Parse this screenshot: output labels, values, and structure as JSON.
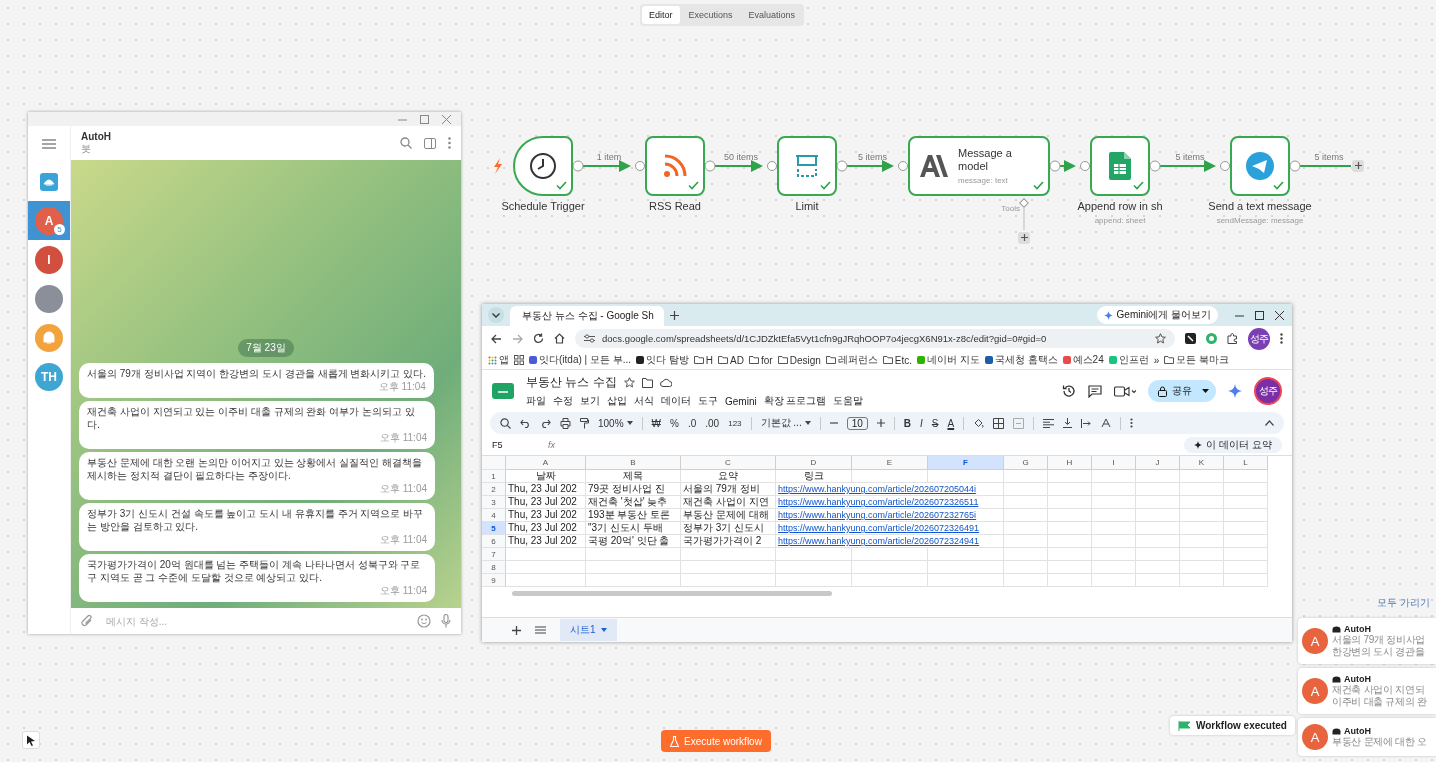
{
  "tabs": [
    {
      "label": "Editor",
      "selected": true
    },
    {
      "label": "Executions",
      "selected": false
    },
    {
      "label": "Evaluations",
      "selected": false
    }
  ],
  "workflow": {
    "nodes": [
      {
        "kind": "trigger",
        "name": "Schedule Trigger",
        "succeeded": true,
        "output_label": "1 item"
      },
      {
        "kind": "rss",
        "name": "RSS Read",
        "succeeded": true,
        "output_label": "50 items"
      },
      {
        "kind": "limit",
        "name": "Limit",
        "succeeded": true,
        "output_label": "5 items"
      },
      {
        "kind": "model",
        "name": "Message a model",
        "subtitle": "message: text",
        "tool_label": "Tools",
        "succeeded": true
      },
      {
        "kind": "sheets",
        "name": "Append row in sh",
        "subtitle": "append: sheet",
        "succeeded": true,
        "output_label": "5 items"
      },
      {
        "kind": "telegram",
        "name": "Send a text message",
        "subtitle": "sendMessage: message",
        "succeeded": true,
        "output_label": "5 items"
      }
    ]
  },
  "telegram": {
    "chat_title": "AutoH",
    "chat_subtitle": "봇",
    "chats": [
      {
        "kind": "saved",
        "selected": false
      },
      {
        "kind": "letter",
        "initials": "A",
        "color": "#e0604a",
        "unread": "5",
        "selected": true
      },
      {
        "kind": "letter",
        "initials": "I",
        "color": "#d24f40",
        "selected": false
      },
      {
        "kind": "photo",
        "selected": false
      },
      {
        "kind": "bell",
        "color": "#f3a33d",
        "selected": false
      },
      {
        "kind": "letter",
        "initials": "TH",
        "color": "#3fa6d4",
        "selected": false
      }
    ],
    "date": "7월 23일",
    "messages": [
      {
        "text": "서울의 79개 정비사업 지역이 한강변의 도시 경관을 새롭게 변화시키고 있다.",
        "time": "오후 11:04"
      },
      {
        "text": "재건축 사업이 지연되고 있는 이주비 대출 규제의 완화 여부가 논의되고 있다.",
        "time": "오후 11:04"
      },
      {
        "text": "부동산 문제에 대한 오랜 논의만 이어지고 있는 상황에서 실질적인 해결책을 제시하는 정치적 결단이 필요하다는 주장이다.",
        "time": "오후 11:04"
      },
      {
        "text": "정부가 3기 신도시 건설 속도를 높이고 도시 내 유휴지를 주거 지역으로 바꾸는 방안을 검토하고 있다.",
        "time": "오후 11:04"
      },
      {
        "text": "국가평가가격이 20억 원대를 넘는 주택들이 계속 나타나면서 성북구와 구로구 지역도 곧 그 수준에 도달할 것으로 예상되고 있다.",
        "time": "오후 11:04"
      }
    ],
    "input_placeholder": "메시지 작성..."
  },
  "sheets": {
    "tab_title": "부동산 뉴스 수집 - Google Sh",
    "gemini_button": "Gemini에게 물어보기",
    "url": "docs.google.com/spreadsheets/d/1CJDZktEfa5Vyt1cfn9gJRqhOOP7o4jecgX6N91x-z8c/edit?gid=0#gid=0",
    "profile": "성주",
    "bookmarks": [
      {
        "kind": "apps",
        "label": "앱"
      },
      {
        "kind": "groups"
      },
      {
        "kind": "site",
        "label": "잇다(itda) | 모든 부...",
        "color": "#4b5bd6"
      },
      {
        "kind": "site",
        "label": "잇다 탐방",
        "color": "#222222"
      },
      {
        "kind": "folder",
        "label": "H"
      },
      {
        "kind": "folder",
        "label": "AD"
      },
      {
        "kind": "folder",
        "label": "for"
      },
      {
        "kind": "folder",
        "label": "Design"
      },
      {
        "kind": "folder",
        "label": "레퍼런스"
      },
      {
        "kind": "folder",
        "label": "Etc."
      },
      {
        "kind": "site",
        "label": "네이버 지도",
        "color": "#2db400"
      },
      {
        "kind": "site",
        "label": "국세청 홈택스",
        "color": "#1b5fab"
      },
      {
        "kind": "site",
        "label": "예스24",
        "color": "#e94a4a"
      },
      {
        "kind": "site",
        "label": "인프런",
        "color": "#19c37d"
      },
      {
        "kind": "more",
        "label": "»"
      },
      {
        "kind": "folder",
        "label": "모든 북마크"
      }
    ],
    "doc_title": "부동산 뉴스 수집",
    "menus": [
      "파일",
      "수정",
      "보기",
      "삽입",
      "서식",
      "데이터",
      "도구",
      "Gemini",
      "확장 프로그램",
      "도움말"
    ],
    "share": "공유",
    "user": "성주",
    "toolbar": {
      "zoom": "100%",
      "currency": "₩",
      "percent": "%",
      "decimal_less": ".0",
      "decimal_more": ".00",
      "more_formats": "123",
      "font": "기본값 ...",
      "font_size": "10",
      "bold": "B",
      "italic": "I",
      "strike": "S",
      "text_color": "A"
    },
    "name_box": "F5",
    "fx": "fx",
    "summarize": "이 데이터 요약",
    "columns": [
      {
        "label": "A",
        "selected": false
      },
      {
        "label": "B",
        "selected": false
      },
      {
        "label": "C",
        "selected": false
      },
      {
        "label": "D",
        "selected": false
      },
      {
        "label": "E",
        "selected": false
      },
      {
        "label": "F",
        "selected": true
      },
      {
        "label": "G",
        "selected": false
      },
      {
        "label": "H",
        "selected": false
      },
      {
        "label": "I",
        "selected": false
      },
      {
        "label": "J",
        "selected": false
      },
      {
        "label": "K",
        "selected": false
      },
      {
        "label": "L",
        "selected": false
      }
    ],
    "rows": [
      {
        "number": "1",
        "selected": false,
        "kind": "header",
        "cells": [
          "날짜",
          "제목",
          "요약",
          "링크"
        ]
      },
      {
        "number": "2",
        "selected": false,
        "kind": "data",
        "cells": [
          "Thu, 23 Jul 202",
          "79곳 정비사업 진",
          "서울의 79개 정비",
          "https://www.hankyung.com/article/202607205044i"
        ]
      },
      {
        "number": "3",
        "selected": false,
        "kind": "data",
        "cells": [
          "Thu, 23 Jul 202",
          "재건축 '첫삽' 늦추",
          "재건축 사업이 지연",
          "https://www.hankyung.com/article/2026072326511"
        ]
      },
      {
        "number": "4",
        "selected": false,
        "kind": "data",
        "cells": [
          "Thu, 23 Jul 202",
          "193분 부동산 토론",
          "부동산 문제에 대해",
          "https://www.hankyung.com/article/202607232765i"
        ]
      },
      {
        "number": "5",
        "selected": true,
        "kind": "data",
        "cells": [
          "Thu, 23 Jul 202",
          "\"3기 신도시 두배",
          "정부가 3기 신도시",
          "https://www.hankyung.com/article/2026072326491"
        ]
      },
      {
        "number": "6",
        "selected": false,
        "kind": "data",
        "cells": [
          "Thu, 23 Jul 202",
          "국평 20억' 잇단 출",
          "국가평가가격이 2",
          "https://www.hankyung.com/article/2026072324941"
        ]
      },
      {
        "number": "7",
        "selected": false,
        "kind": "blank"
      },
      {
        "number": "8",
        "selected": false,
        "kind": "blank"
      },
      {
        "number": "9",
        "selected": false,
        "kind": "blank"
      }
    ],
    "sheet_tabs": [
      {
        "label": "시트1",
        "selected": true
      }
    ]
  },
  "notifications": {
    "dismiss_all": "모두 가리기",
    "items": [
      {
        "initial": "A",
        "sender": "AutoH",
        "lines": [
          "서울의 79개 정비사업",
          "한강변의 도시 경관을"
        ]
      },
      {
        "initial": "A",
        "sender": "AutoH",
        "lines": [
          "재건축 사업이 지연되",
          "이주비 대출 규제의 완"
        ]
      },
      {
        "initial": "A",
        "sender": "AutoH",
        "lines": [
          "부동산 문제에 대한 오"
        ]
      }
    ]
  },
  "toast": "Workflow executed",
  "execute_button": "Execute workflow"
}
